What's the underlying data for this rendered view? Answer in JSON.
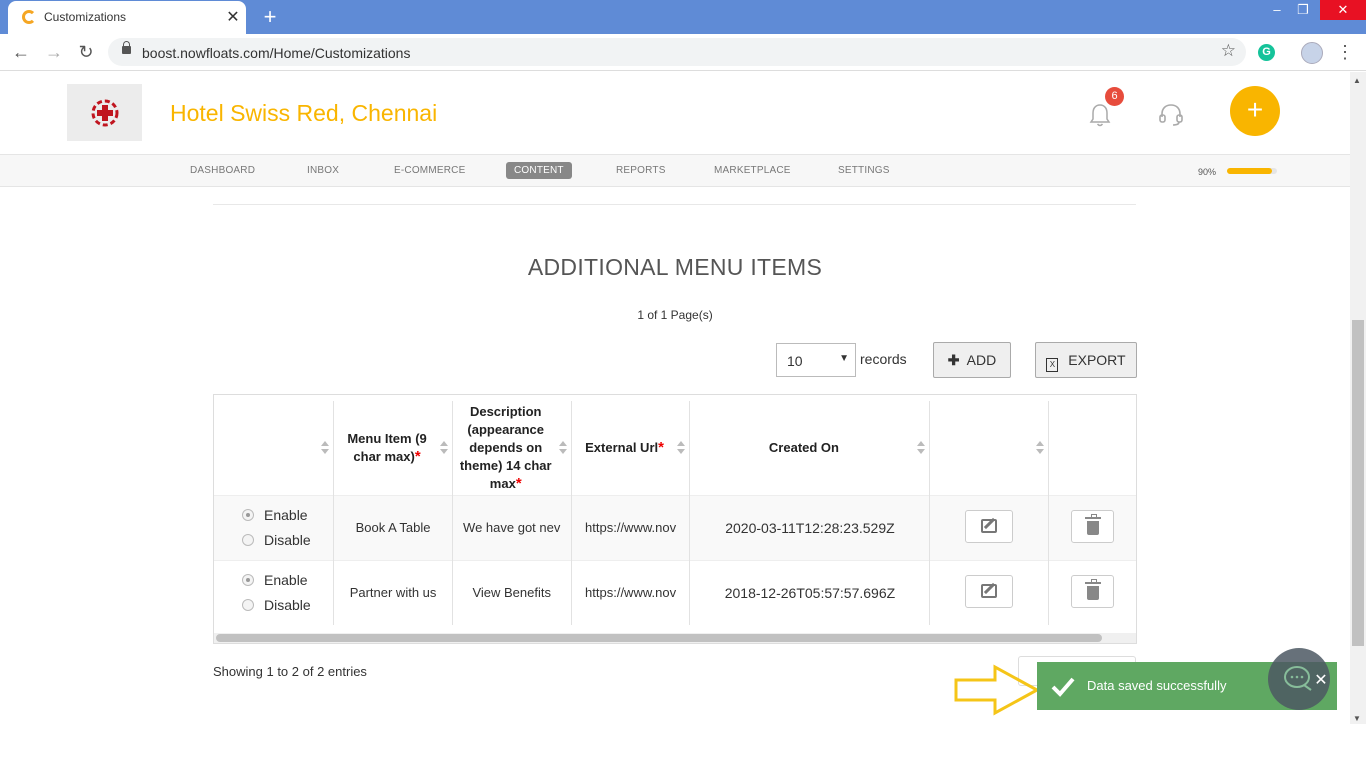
{
  "browser": {
    "tab_title": "Customizations",
    "tab_close": "✕",
    "new_tab": "+",
    "url": "boost.nowfloats.com/Home/Customizations",
    "back": "←",
    "forward": "→",
    "reload": "↻",
    "star": "☆",
    "ext_letter": "G",
    "kebab": "⋮",
    "win_min": "–",
    "win_max": "❐",
    "win_close": "✕"
  },
  "header": {
    "brand": "Hotel Swiss Red, Chennai",
    "notif_count": "6",
    "fab_label": "+"
  },
  "nav": {
    "items": [
      "DASHBOARD",
      "INBOX",
      "E-COMMERCE",
      "CONTENT",
      "REPORTS",
      "MARKETPLACE",
      "SETTINGS"
    ],
    "active": "CONTENT",
    "progress_label": "90%",
    "progress": 0.9
  },
  "section": {
    "title": "ADDITIONAL MENU ITEMS",
    "pages": "1 of 1 Page(s)"
  },
  "controls": {
    "records_value": "10",
    "records_label": "records",
    "add_label": "ADD",
    "export_label": "EXPORT"
  },
  "table": {
    "headers": {
      "menu_item": "Menu Item (9 char max)",
      "description": "Description (appearance depends on theme) 14 char max",
      "external_url": "External Url",
      "created_on": "Created On",
      "required_mark": "*"
    },
    "enable_label": "Enable",
    "disable_label": "Disable",
    "rows": [
      {
        "status": "Enable",
        "menu_item": "Book A Table",
        "description": "We have got nev",
        "url": "https://www.nov",
        "created_on": "2020-03-11T12:28:23.529Z"
      },
      {
        "status": "Enable",
        "menu_item": "Partner with us",
        "description": "View Benefits",
        "url": "https://www.nov",
        "created_on": "2018-12-26T05:57:57.696Z"
      }
    ]
  },
  "footer": {
    "showing": "Showing 1 to 2 of 2 entries"
  },
  "toast": {
    "message": "Data saved successfully",
    "close": "✕"
  },
  "colors": {
    "brand": "#f9b500",
    "toast": "#5fa862",
    "chrome": "#5f8bd6",
    "badge": "#e74c3c"
  }
}
